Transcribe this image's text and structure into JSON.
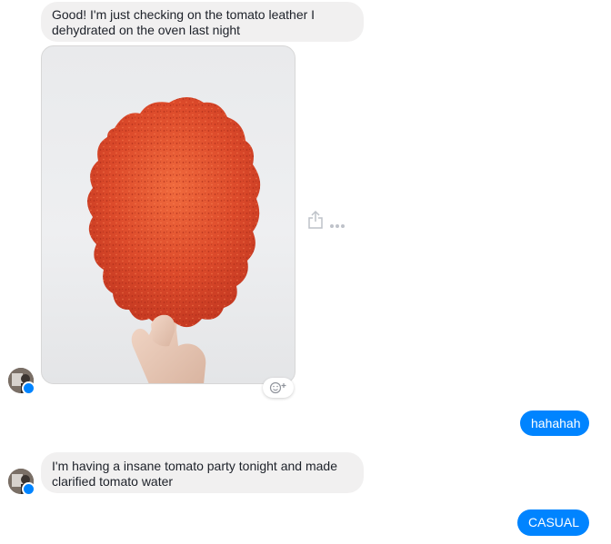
{
  "thread": {
    "messages": [
      {
        "direction": "incoming",
        "text": "Good! I'm just checking on the tomato leather I dehydrated on the oven last night"
      },
      {
        "direction": "incoming",
        "attachment": "photo",
        "subject": "tomato leather held up by a hand"
      },
      {
        "direction": "outgoing",
        "text": "hahahah"
      },
      {
        "direction": "incoming",
        "text": "I'm having a insane tomato party tonight and made clarified tomato water"
      },
      {
        "direction": "outgoing",
        "text": "CASUAL"
      }
    ]
  },
  "icons": {
    "share": "share-icon",
    "more": "more-options-icon",
    "reaction": "add-reaction-icon",
    "messenger_badge": "messenger-badge-icon"
  },
  "colors": {
    "incoming_bubble": "#f1f0f0",
    "outgoing_bubble": "#0084ff",
    "incoming_text": "#1d2129",
    "outgoing_text": "#ffffff",
    "tomato_leather": "#d8452a"
  }
}
